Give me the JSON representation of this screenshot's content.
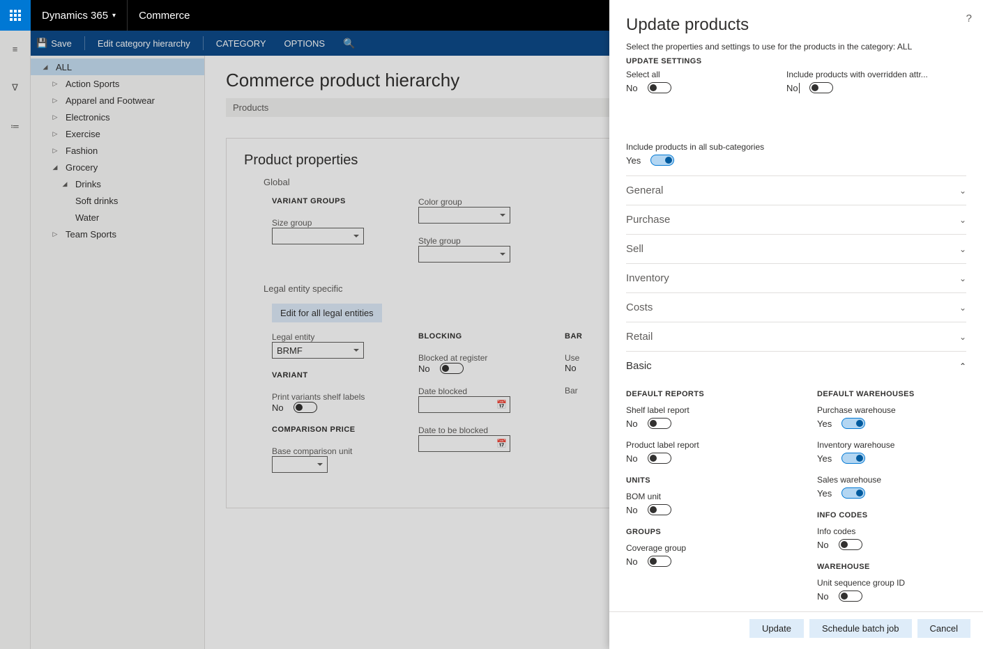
{
  "topbar": {
    "app": "Dynamics 365",
    "module": "Commerce"
  },
  "actionbar": {
    "save": "Save",
    "edit_hierarchy": "Edit category hierarchy",
    "category": "CATEGORY",
    "options": "OPTIONS"
  },
  "tree": {
    "all": "ALL",
    "items": [
      {
        "label": "Action Sports",
        "expanded": false
      },
      {
        "label": "Apparel and Footwear",
        "expanded": false
      },
      {
        "label": "Electronics",
        "expanded": false
      },
      {
        "label": "Exercise",
        "expanded": false
      },
      {
        "label": "Fashion",
        "expanded": false
      },
      {
        "label": "Grocery",
        "expanded": true,
        "children": [
          {
            "label": "Drinks",
            "expanded": true,
            "children": [
              {
                "label": "Soft drinks"
              },
              {
                "label": "Water"
              }
            ]
          }
        ]
      },
      {
        "label": "Team Sports",
        "expanded": false
      }
    ]
  },
  "main": {
    "title": "Commerce product hierarchy",
    "section": "Products",
    "props_title": "Product properties",
    "global": "Global",
    "variant_groups_h": "VARIANT GROUPS",
    "size_group": "Size group",
    "color_group": "Color group",
    "style_group": "Style group",
    "legal_entity_specific": "Legal entity specific",
    "edit_all_legal": "Edit for all legal entities",
    "legal_entity": "Legal entity",
    "legal_entity_val": "BRMF",
    "variant_h": "VARIANT",
    "print_variants": "Print variants shelf labels",
    "print_variants_val": "No",
    "comparison_h": "COMPARISON PRICE",
    "base_comparison": "Base comparison unit",
    "blocking_h": "BLOCKING",
    "blocked_at_reg": "Blocked at register",
    "blocked_at_reg_val": "No",
    "date_blocked": "Date blocked",
    "date_tobe": "Date to be blocked",
    "barcode_h": "BAR",
    "use_b": "Use",
    "use_b_val": "No",
    "bar_c": "Bar"
  },
  "flyout": {
    "title": "Update products",
    "instruction": "Select the properties and settings to use for the products in the category: ALL",
    "update_settings_h": "UPDATE SETTINGS",
    "select_all": {
      "label": "Select all",
      "val": "No"
    },
    "include_overridden": {
      "label": "Include products with overridden attr...",
      "val": "No"
    },
    "include_subcats": {
      "label": "Include products in all sub-categories",
      "val": "Yes"
    },
    "sections": {
      "general": "General",
      "purchase": "Purchase",
      "sell": "Sell",
      "inventory": "Inventory",
      "costs": "Costs",
      "retail": "Retail",
      "basic": "Basic"
    },
    "basic": {
      "default_reports_h": "DEFAULT REPORTS",
      "shelf_label": {
        "label": "Shelf label report",
        "val": "No"
      },
      "product_label": {
        "label": "Product label report",
        "val": "No"
      },
      "units_h": "UNITS",
      "bom_unit": {
        "label": "BOM unit",
        "val": "No"
      },
      "groups_h": "GROUPS",
      "coverage": {
        "label": "Coverage group",
        "val": "No"
      },
      "default_wh_h": "DEFAULT WAREHOUSES",
      "purchase_wh": {
        "label": "Purchase warehouse",
        "val": "Yes"
      },
      "inventory_wh": {
        "label": "Inventory warehouse",
        "val": "Yes"
      },
      "sales_wh": {
        "label": "Sales warehouse",
        "val": "Yes"
      },
      "info_codes_h": "INFO CODES",
      "info_codes": {
        "label": "Info codes",
        "val": "No"
      },
      "warehouse_h": "WAREHOUSE",
      "unit_seq": {
        "label": "Unit sequence group ID",
        "val": "No"
      }
    },
    "buttons": {
      "update": "Update",
      "schedule": "Schedule batch job",
      "cancel": "Cancel"
    }
  }
}
